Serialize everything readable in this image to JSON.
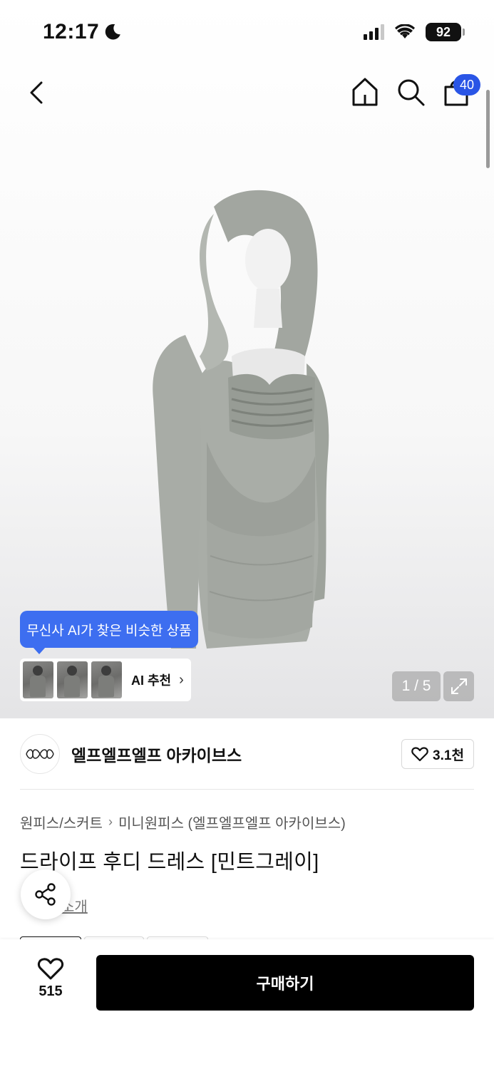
{
  "status_bar": {
    "time": "12:17",
    "battery": "92"
  },
  "nav": {
    "cart_count": "40"
  },
  "gallery": {
    "page_indicator": "1 / 5"
  },
  "ai": {
    "tooltip": "무신사 AI가 찾은 비슷한 상품",
    "label": "AI 추천"
  },
  "brand": {
    "name": "엘프엘프엘프 아카이브스",
    "likes": "3.1천"
  },
  "breadcrumb": [
    "원피스/스커트",
    "미니원피스 (엘프엘프엘프 아카이브스)"
  ],
  "product": {
    "title": "드라이프 후디 드레스 [민트그레이]",
    "review_link_partial": "소개"
  },
  "bottom": {
    "wish_count": "515",
    "buy_label": "구매하기"
  },
  "colors": {
    "accent_blue": "#3d6ef0",
    "badge_blue": "#2a55e6",
    "buy_button": "#000000"
  },
  "icons": [
    "moon-icon",
    "back-icon",
    "home-icon",
    "search-icon",
    "cart-icon",
    "expand-icon",
    "heart-icon",
    "share-icon"
  ]
}
